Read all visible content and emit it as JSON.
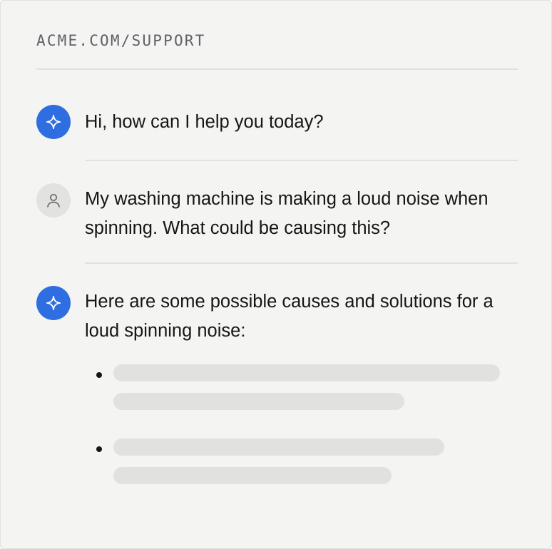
{
  "header": {
    "url": "ACME.COM/SUPPORT"
  },
  "messages": [
    {
      "role": "assistant",
      "avatar_icon": "sparkle-icon",
      "text": "Hi, how can I help you today?"
    },
    {
      "role": "user",
      "avatar_icon": "user-icon",
      "text": "My washing machine is making a loud noise when spinning. What could be causing this?"
    },
    {
      "role": "assistant",
      "avatar_icon": "sparkle-icon",
      "text": "Here are some possible causes and solutions for a loud spinning noise:",
      "list_items_loading": 2
    }
  ],
  "colors": {
    "background": "#f4f4f3",
    "assistant_avatar": "#2e6ee0",
    "user_avatar": "#e2e2e1",
    "divider": "#e1e1df",
    "skeleton": "#e1e1df",
    "text": "#151515",
    "url_text": "#5f6166"
  }
}
